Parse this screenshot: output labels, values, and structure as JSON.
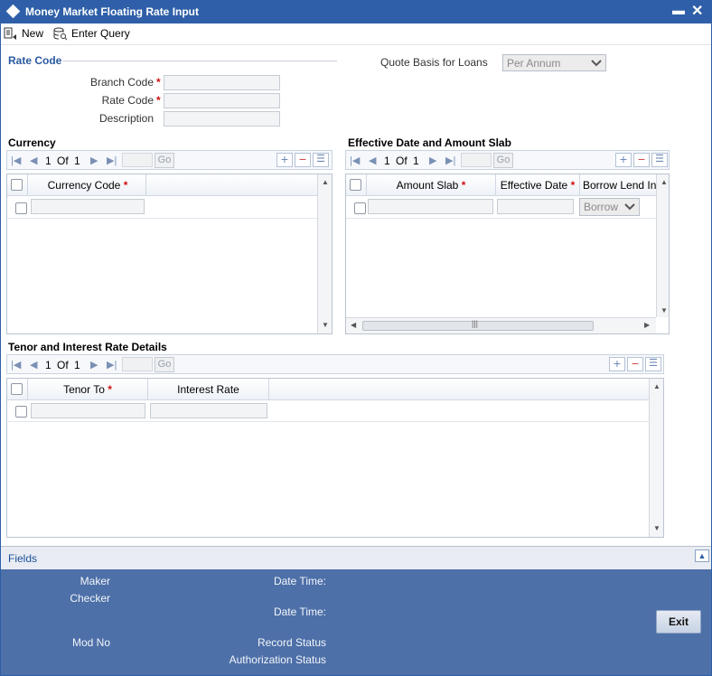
{
  "window": {
    "title": "Money Market Floating Rate Input"
  },
  "toolbar": {
    "new_label": "New",
    "enter_query_label": "Enter Query"
  },
  "rate_code": {
    "legend": "Rate Code",
    "branch_code_label": "Branch Code",
    "rate_code_label": "Rate Code",
    "description_label": "Description",
    "required_mark": "*",
    "quote_basis_label": "Quote Basis for Loans",
    "quote_basis_value": "Per Annum"
  },
  "currency": {
    "title": "Currency",
    "page": "1",
    "of_label": "Of",
    "total": "1",
    "go_label": "Go",
    "columns": [
      "Currency Code"
    ]
  },
  "effective": {
    "title": "Effective Date and Amount Slab",
    "page": "1",
    "of_label": "Of",
    "total": "1",
    "go_label": "Go",
    "columns": [
      "Amount Slab",
      "Effective Date",
      "Borrow Lend In"
    ],
    "borrow_select_value": "Borrow"
  },
  "tenor": {
    "title": "Tenor and Interest Rate Details",
    "page": "1",
    "of_label": "Of",
    "total": "1",
    "go_label": "Go",
    "columns": [
      "Tenor To",
      "Interest Rate"
    ]
  },
  "footer": {
    "fields_link": "Fields",
    "maker_label": "Maker",
    "checker_label": "Checker",
    "mod_no_label": "Mod No",
    "date_time_label": "Date Time:",
    "record_status_label": "Record Status",
    "authorization_status_label": "Authorization Status",
    "exit_label": "Exit"
  },
  "colors": {
    "title_bar": "#2f5fa8",
    "footer": "#4e70a8",
    "accent_text": "#2a5aa0",
    "required": "#d01010"
  },
  "icons": [
    "diamond-icon",
    "minimize-icon",
    "close-icon",
    "new-icon",
    "enter-query-icon",
    "first-page-icon",
    "prev-page-icon",
    "next-page-icon",
    "last-page-icon",
    "add-row-icon",
    "delete-row-icon",
    "single-view-icon",
    "collapse-icon"
  ]
}
